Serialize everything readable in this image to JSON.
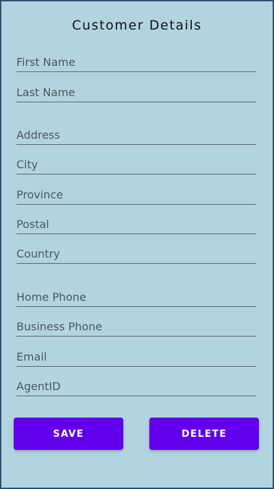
{
  "page_title": "Customer Details",
  "fields": {
    "first_name": {
      "placeholder": "First Name",
      "value": ""
    },
    "last_name": {
      "placeholder": "Last Name",
      "value": ""
    },
    "address": {
      "placeholder": "Address",
      "value": ""
    },
    "city": {
      "placeholder": "City",
      "value": ""
    },
    "province": {
      "placeholder": "Province",
      "value": ""
    },
    "postal": {
      "placeholder": "Postal",
      "value": ""
    },
    "country": {
      "placeholder": "Country",
      "value": ""
    },
    "home_phone": {
      "placeholder": "Home Phone",
      "value": ""
    },
    "business_phone": {
      "placeholder": "Business Phone",
      "value": ""
    },
    "email": {
      "placeholder": "Email",
      "value": ""
    },
    "agent_id": {
      "placeholder": "AgentID",
      "value": ""
    }
  },
  "buttons": {
    "save_label": "SAVE",
    "delete_label": "DELETE"
  },
  "colors": {
    "background": "#b2d4e0",
    "button": "#6200ee",
    "button_text": "#ffffff",
    "underline": "#59656a",
    "placeholder_text": "#4b575b"
  }
}
